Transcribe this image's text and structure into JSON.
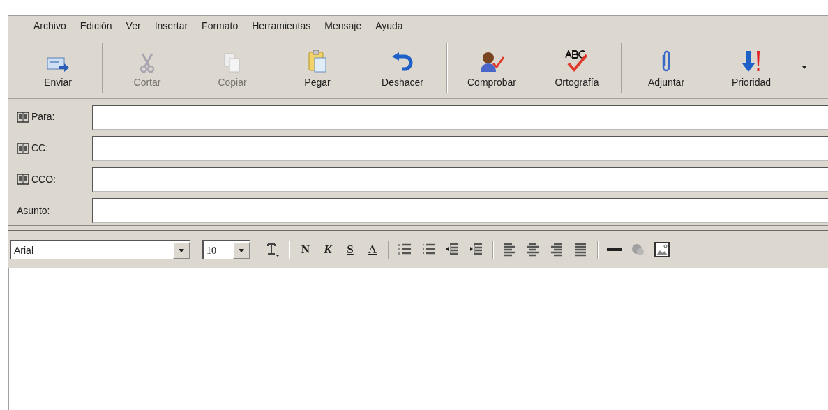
{
  "menu": [
    "Archivo",
    "Edición",
    "Ver",
    "Insertar",
    "Formato",
    "Herramientas",
    "Mensaje",
    "Ayuda"
  ],
  "toolbar": {
    "groups": [
      [
        {
          "label": "Enviar",
          "disabled": false
        }
      ],
      [
        {
          "label": "Cortar",
          "disabled": true
        },
        {
          "label": "Copiar",
          "disabled": true
        },
        {
          "label": "Pegar",
          "disabled": false
        },
        {
          "label": "Deshacer",
          "disabled": false
        }
      ],
      [
        {
          "label": "Comprobar",
          "disabled": false
        },
        {
          "label": "Ortografía",
          "disabled": false
        }
      ],
      [
        {
          "label": "Adjuntar",
          "disabled": false
        },
        {
          "label": "Prioridad",
          "disabled": false
        }
      ]
    ]
  },
  "header_fields": [
    {
      "label": "Para:",
      "kind": "address"
    },
    {
      "label": "CC:",
      "kind": "address"
    },
    {
      "label": "CCO:",
      "kind": "address"
    },
    {
      "label": "Asunto:",
      "kind": "plain"
    }
  ],
  "format_bar": {
    "font": "Arial",
    "size": "10",
    "style_buttons": [
      "N",
      "K",
      "S",
      "A"
    ]
  }
}
